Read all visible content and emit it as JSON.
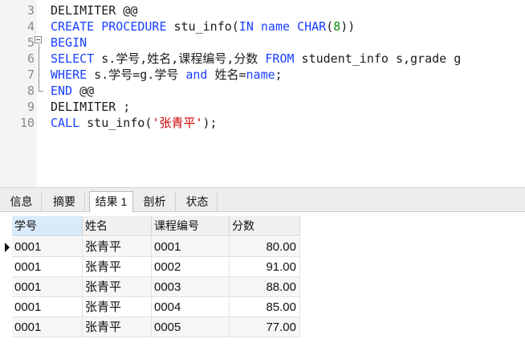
{
  "editor": {
    "lines": [
      {
        "num": "3",
        "parts": [
          {
            "t": "DELIMITER @@",
            "c": ""
          }
        ]
      },
      {
        "num": "4",
        "parts": [
          {
            "t": "CREATE PROCEDURE",
            "c": "kw"
          },
          {
            "t": " stu_info(",
            "c": ""
          },
          {
            "t": "IN",
            "c": "kw"
          },
          {
            "t": " ",
            "c": ""
          },
          {
            "t": "name",
            "c": "kw"
          },
          {
            "t": " ",
            "c": ""
          },
          {
            "t": "CHAR",
            "c": "kw"
          },
          {
            "t": "(",
            "c": ""
          },
          {
            "t": "8",
            "c": "num"
          },
          {
            "t": "))",
            "c": ""
          }
        ]
      },
      {
        "num": "5",
        "parts": [
          {
            "t": "BEGIN",
            "c": "kw"
          }
        ]
      },
      {
        "num": "6",
        "parts": [
          {
            "t": "SELECT",
            "c": "kw"
          },
          {
            "t": " s.学号,姓名,课程编号,分数 ",
            "c": ""
          },
          {
            "t": "FROM",
            "c": "kw"
          },
          {
            "t": " student_info s,grade g",
            "c": ""
          }
        ]
      },
      {
        "num": "7",
        "parts": [
          {
            "t": "WHERE",
            "c": "kw"
          },
          {
            "t": " s.学号=g.学号 ",
            "c": ""
          },
          {
            "t": "and",
            "c": "kw"
          },
          {
            "t": " 姓名=",
            "c": ""
          },
          {
            "t": "name",
            "c": "kw"
          },
          {
            "t": ";",
            "c": ""
          }
        ]
      },
      {
        "num": "8",
        "parts": [
          {
            "t": "END",
            "c": "kw"
          },
          {
            "t": " @@",
            "c": ""
          }
        ]
      },
      {
        "num": "9",
        "parts": [
          {
            "t": "DELIMITER ;",
            "c": ""
          }
        ]
      },
      {
        "num": "10",
        "parts": [
          {
            "t": "CALL",
            "c": "kw"
          },
          {
            "t": " stu_info(",
            "c": ""
          },
          {
            "t": "'张青平'",
            "c": "str"
          },
          {
            "t": ");",
            "c": ""
          }
        ]
      }
    ]
  },
  "tabs": [
    {
      "label": "信息",
      "active": false
    },
    {
      "label": "摘要",
      "active": false
    },
    {
      "label": "结果 1",
      "active": true
    },
    {
      "label": "剖析",
      "active": false
    },
    {
      "label": "状态",
      "active": false
    }
  ],
  "result": {
    "columns": [
      "学号",
      "姓名",
      "课程编号",
      "分数"
    ],
    "rows": [
      [
        "0001",
        "张青平",
        "0001",
        "80.00"
      ],
      [
        "0001",
        "张青平",
        "0002",
        "91.00"
      ],
      [
        "0001",
        "张青平",
        "0003",
        "88.00"
      ],
      [
        "0001",
        "张青平",
        "0004",
        "85.00"
      ],
      [
        "0001",
        "张青平",
        "0005",
        "77.00"
      ]
    ],
    "current_row": 0
  },
  "colors": {
    "keyword": "#1a3fff",
    "number": "#0a8a0a",
    "string": "#cc0000"
  }
}
